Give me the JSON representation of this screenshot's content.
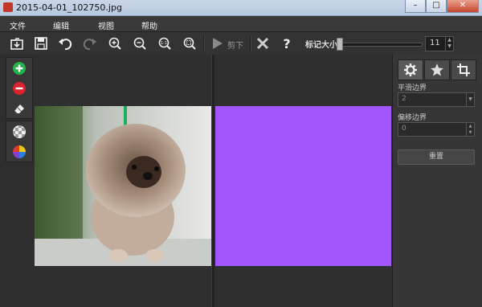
{
  "window": {
    "title": "2015-04-01_102750.jpg"
  },
  "menu": {
    "file": "文件",
    "edit": "编辑",
    "view": "视图",
    "help": "帮助"
  },
  "toolbar": {
    "crop_label": "剪下",
    "mark_size_label": "标记大小",
    "mark_size_value": "11"
  },
  "right_panel": {
    "smooth_label": "平滑边界",
    "smooth_value": "2",
    "offset_label": "偏移边界",
    "offset_value": "0",
    "reset_label": "重置"
  },
  "colors": {
    "mask": "#a356fb",
    "accent_green": "#22b14c",
    "accent_red": "#d9232d"
  }
}
